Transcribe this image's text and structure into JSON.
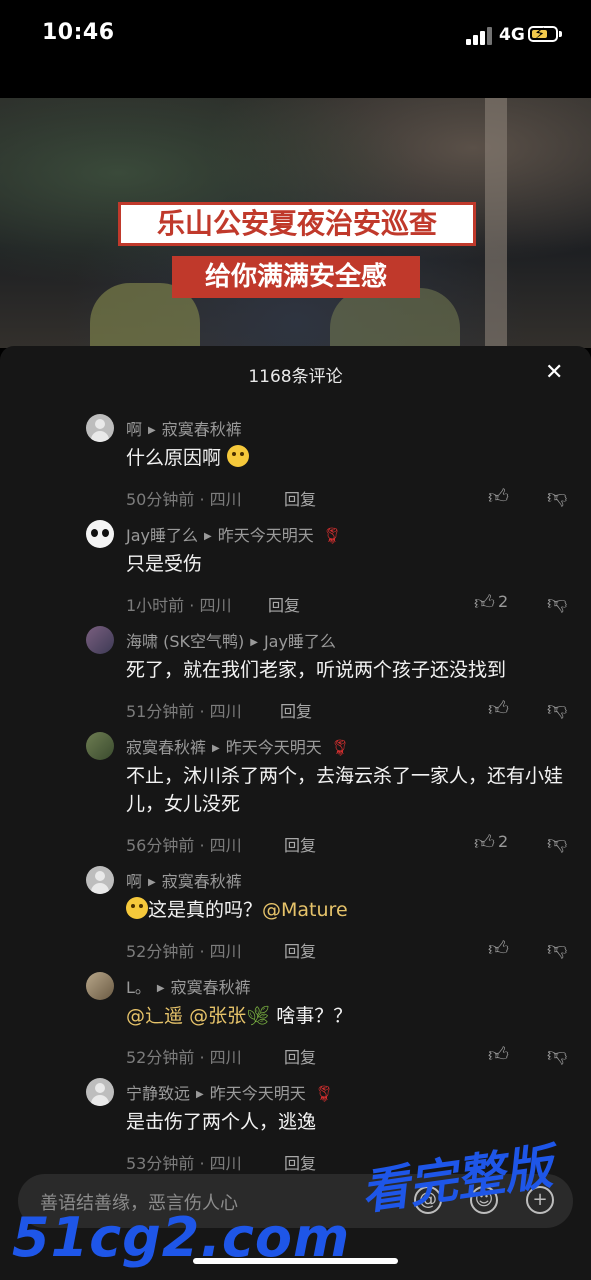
{
  "status": {
    "time": "10:46",
    "network": "4G"
  },
  "video": {
    "headline": "乐山公安夏夜治安巡查",
    "subheadline": "给你满满安全感"
  },
  "sheet": {
    "title": "1168条评论",
    "close": "✕"
  },
  "comments": [
    {
      "user": "啊",
      "reply_to": "寂寞春秋裤",
      "text": "什么原因啊",
      "time_loc": "50分钟前 · 四川",
      "reply": "回复",
      "likes": ""
    },
    {
      "user": "Jay睡了么",
      "reply_to": "昨天今天明天",
      "text": "只是受伤",
      "time_loc": "1小时前 · 四川",
      "reply": "回复",
      "likes": "2"
    },
    {
      "user": "海啸 (SK空气鸭)",
      "reply_to": "Jay睡了么",
      "text": "死了，就在我们老家，听说两个孩子还没找到",
      "time_loc": "51分钟前 · 四川",
      "reply": "回复",
      "likes": ""
    },
    {
      "user": "寂寞春秋裤",
      "reply_to": "昨天今天明天",
      "text": "不止，沐川杀了两个，去海云杀了一家人，还有小娃儿，女儿没死",
      "time_loc": "56分钟前 · 四川",
      "reply": "回复",
      "likes": "2"
    },
    {
      "user": "啊",
      "reply_to": "寂寞春秋裤",
      "text": "这是真的吗？",
      "mention": "@Mature",
      "time_loc": "52分钟前 · 四川",
      "reply": "回复",
      "likes": ""
    },
    {
      "user": "L。",
      "reply_to": "寂寞春秋裤",
      "mention1": "@辶遥",
      "mention2": "@张张",
      "text": "啥事？？",
      "time_loc": "52分钟前 · 四川",
      "reply": "回复",
      "likes": ""
    },
    {
      "user": "宁静致远",
      "reply_to": "昨天今天明天",
      "text": "是击伤了两个人，逃逸",
      "time_loc": "53分钟前 · 四川",
      "reply": "回复",
      "likes": ""
    }
  ],
  "input": {
    "placeholder": "善语结善缘，恶言伤人心"
  },
  "watermark": {
    "text1": "51cg2.com",
    "text2": "看完整版"
  },
  "icons": {
    "like": "thumb-up-icon",
    "dislike": "thumb-down-icon",
    "at": "at-icon",
    "emoji": "emoji-icon",
    "add": "plus-icon"
  }
}
